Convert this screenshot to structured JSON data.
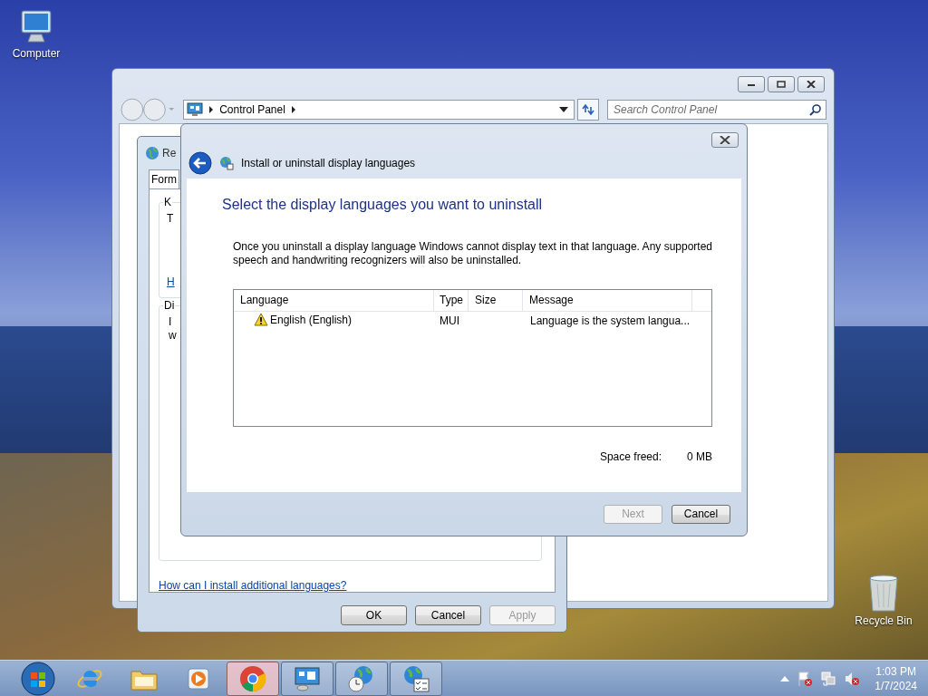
{
  "desktop_icons": [
    {
      "kind": "computer",
      "label": "Computer"
    },
    {
      "kind": "recycle-bin",
      "label": "Recycle Bin"
    }
  ],
  "control_panel_window": {
    "address_path": [
      "Control Panel"
    ],
    "search": {
      "placeholder": "Search Control Panel"
    }
  },
  "region_dialog": {
    "title": "Re",
    "tabs": [
      {
        "label": "Form",
        "selected": true
      }
    ],
    "groups": [
      {
        "legend": "K",
        "lines": [
          "T"
        ],
        "link": "H"
      },
      {
        "legend": "Di",
        "lines": [
          "I",
          "w"
        ]
      }
    ],
    "link": "How can I install additional languages?",
    "buttons": [
      {
        "label": "OK",
        "disabled": false
      },
      {
        "label": "Cancel",
        "disabled": false
      },
      {
        "label": "Apply",
        "disabled": true
      }
    ]
  },
  "install_dialog": {
    "title": "Install or uninstall display languages",
    "heading": "Select the display languages you want to uninstall",
    "description": "Once you uninstall a display language Windows cannot display text in that language. Any supported speech and handwriting recognizers will also be uninstalled.",
    "list": {
      "columns": [
        "Language",
        "Type",
        "Size",
        "Message"
      ],
      "rows": [
        {
          "language": "English (English)",
          "type": "MUI",
          "message": "Language is the system langua..."
        }
      ]
    },
    "space_freed_label": "Space freed:",
    "space_freed_value": "0 MB",
    "buttons": [
      {
        "label": "Next",
        "disabled": true
      },
      {
        "label": "Cancel",
        "disabled": false
      }
    ]
  },
  "taskbar": {
    "items": [
      {
        "kind": "browser-e",
        "selected": false
      },
      {
        "kind": "folder",
        "selected": false
      },
      {
        "kind": "media",
        "selected": false
      },
      {
        "kind": "chrome",
        "selected": true
      },
      {
        "kind": "control-panel",
        "selected": false
      },
      {
        "kind": "globe-clock",
        "selected": false
      },
      {
        "kind": "globe-list",
        "selected": false
      }
    ],
    "time": "1:03 PM",
    "date": "1/7/2024"
  }
}
